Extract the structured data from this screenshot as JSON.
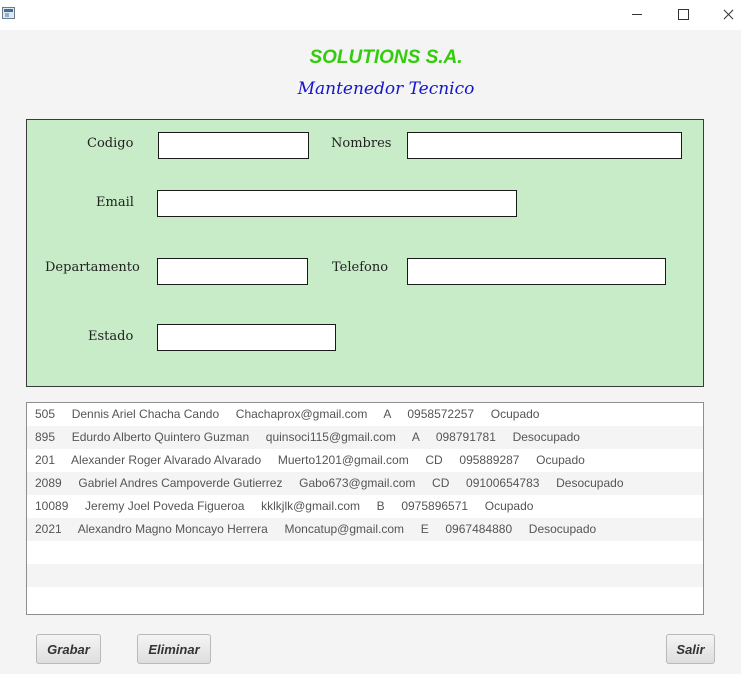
{
  "window": {
    "title": ""
  },
  "header": {
    "company": "SOLUTIONS S.A.",
    "subtitle": "Mantenedor Tecnico"
  },
  "form": {
    "codigo_label": "Codigo",
    "nombres_label": "Nombres",
    "email_label": "Email",
    "departamento_label": "Departamento",
    "telefono_label": "Telefono",
    "estado_label": "Estado",
    "codigo_value": "",
    "nombres_value": "",
    "email_value": "",
    "departamento_value": "",
    "telefono_value": "",
    "estado_value": ""
  },
  "list": {
    "rows": [
      "505     Dennis Ariel Chacha Cando     Chachaprox@gmail.com     A     0958572257     Ocupado",
      "895     Edurdo Alberto Quintero Guzman     quinsoci115@gmail.com     A     098791781     Desocupado",
      "201     Alexander Roger Alvarado Alvarado     Muerto1201@gmail.com     CD     095889287     Ocupado",
      "2089     Gabriel Andres Campoverde Gutierrez     Gabo673@gmail.com     CD     09100654783     Desocupado",
      "10089     Jeremy Joel Poveda Figueroa     kklkjlk@gmail.com     B     0975896571     Ocupado",
      "2021     Alexandro Magno Moncayo Herrera     Moncatup@gmail.com     E     0967484880     Desocupado"
    ]
  },
  "buttons": {
    "grabar": "Grabar",
    "eliminar": "Eliminar",
    "salir": "Salir"
  }
}
